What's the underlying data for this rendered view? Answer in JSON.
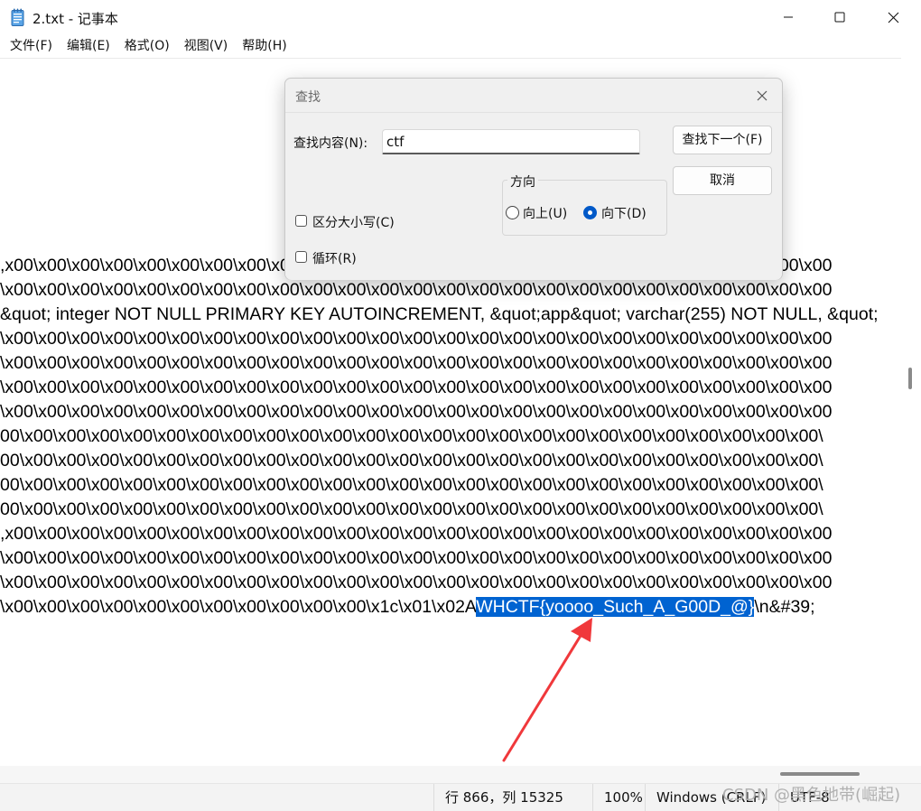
{
  "window": {
    "title": "2.txt - 记事本",
    "colors": {
      "accent": "#0063d1",
      "arrow": "#f0383b"
    }
  },
  "menubar": {
    "items": [
      "文件(F)",
      "编辑(E)",
      "格式(O)",
      "视图(V)",
      "帮助(H)"
    ]
  },
  "editor": {
    "lines": [
      ",x00\\x00\\x00\\x00\\x00\\x00\\x00\\x00\\x00\\x00\\x00\\x00\\x00\\x00\\x00\\x00\\x00\\x00\\x00\\x00\\x00\\x00\\x00\\x00\\x00",
      "\\x00\\x00\\x00\\x00\\x00\\x00\\x00\\x00\\x00\\x00\\x00\\x00\\x00\\x00\\x00\\x00\\x00\\x00\\x00\\x00\\x00\\x00\\x00\\x00\\x00",
      "&quot; integer NOT NULL PRIMARY KEY AUTOINCREMENT, &quot;app&quot; varchar(255) NOT NULL, &quot;",
      "\\x00\\x00\\x00\\x00\\x00\\x00\\x00\\x00\\x00\\x00\\x00\\x00\\x00\\x00\\x00\\x00\\x00\\x00\\x00\\x00\\x00\\x00\\x00\\x00\\x00",
      "\\x00\\x00\\x00\\x00\\x00\\x00\\x00\\x00\\x00\\x00\\x00\\x00\\x00\\x00\\x00\\x00\\x00\\x00\\x00\\x00\\x00\\x00\\x00\\x00\\x00",
      "\\x00\\x00\\x00\\x00\\x00\\x00\\x00\\x00\\x00\\x00\\x00\\x00\\x00\\x00\\x00\\x00\\x00\\x00\\x00\\x00\\x00\\x00\\x00\\x00\\x00",
      "\\x00\\x00\\x00\\x00\\x00\\x00\\x00\\x00\\x00\\x00\\x00\\x00\\x00\\x00\\x00\\x00\\x00\\x00\\x00\\x00\\x00\\x00\\x00\\x00\\x00",
      "00\\x00\\x00\\x00\\x00\\x00\\x00\\x00\\x00\\x00\\x00\\x00\\x00\\x00\\x00\\x00\\x00\\x00\\x00\\x00\\x00\\x00\\x00\\x00\\x00\\",
      "00\\x00\\x00\\x00\\x00\\x00\\x00\\x00\\x00\\x00\\x00\\x00\\x00\\x00\\x00\\x00\\x00\\x00\\x00\\x00\\x00\\x00\\x00\\x00\\x00\\",
      "00\\x00\\x00\\x00\\x00\\x00\\x00\\x00\\x00\\x00\\x00\\x00\\x00\\x00\\x00\\x00\\x00\\x00\\x00\\x00\\x00\\x00\\x00\\x00\\x00\\",
      "00\\x00\\x00\\x00\\x00\\x00\\x00\\x00\\x00\\x00\\x00\\x00\\x00\\x00\\x00\\x00\\x00\\x00\\x00\\x00\\x00\\x00\\x00\\x00\\x00\\",
      ",x00\\x00\\x00\\x00\\x00\\x00\\x00\\x00\\x00\\x00\\x00\\x00\\x00\\x00\\x00\\x00\\x00\\x00\\x00\\x00\\x00\\x00\\x00\\x00\\x00",
      "\\x00\\x00\\x00\\x00\\x00\\x00\\x00\\x00\\x00\\x00\\x00\\x00\\x00\\x00\\x00\\x00\\x00\\x00\\x00\\x00\\x00\\x00\\x00\\x00\\x00",
      "\\x00\\x00\\x00\\x00\\x00\\x00\\x00\\x00\\x00\\x00\\x00\\x00\\x00\\x00\\x00\\x00\\x00\\x00\\x00\\x00\\x00\\x00\\x00\\x00\\x00"
    ],
    "last_line": {
      "before": "\\x00\\x00\\x00\\x00\\x00\\x00\\x00\\x00\\x00\\x00\\x00\\x1c\\x01\\x02A",
      "selected": "WHCTF{yoooo_Such_A_G00D_@}",
      "after": "\\n&#39;"
    }
  },
  "find_dialog": {
    "title": "查找",
    "find_label": "查找内容(N):",
    "find_value": "ctf",
    "find_next_button": "查找下一个(F)",
    "cancel_button": "取消",
    "direction_label": "方向",
    "up_label": "向上(U)",
    "down_label": "向下(D)",
    "direction_selected": "down",
    "match_case_label": "区分大小写(C)",
    "match_case_checked": false,
    "wrap_label": "循环(R)",
    "wrap_checked": false
  },
  "status": {
    "position": "行 866，列 15325",
    "zoom": "100%",
    "line_ending": "Windows (CRLF)",
    "encoding": "UTF-8"
  },
  "watermark": "CSDN @黑色地带(崛起)"
}
